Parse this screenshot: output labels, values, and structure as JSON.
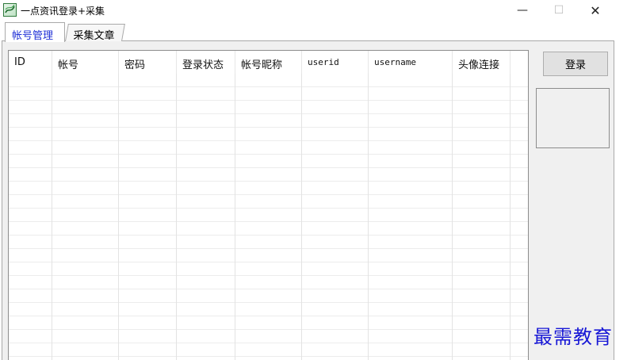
{
  "window": {
    "title": "一点资讯登录+采集",
    "minimize_glyph": "—",
    "maximize_glyph": "☐",
    "close_glyph": "✕"
  },
  "tabs": [
    {
      "label": "帐号管理",
      "active": true
    },
    {
      "label": "采集文章",
      "active": false
    }
  ],
  "table": {
    "columns": [
      "ID",
      "帐号",
      "密码",
      "登录状态",
      "帐号昵称",
      "userid",
      "username",
      "头像连接"
    ],
    "rows": []
  },
  "actions": {
    "login_label": "登录"
  },
  "watermark": "最需教育",
  "icons": {
    "app": "app-logo-icon",
    "minimize": "minimize-icon",
    "maximize": "maximize-icon",
    "close": "close-icon"
  },
  "colors": {
    "active_tab_text": "#1e2fd6",
    "watermark": "#1818d6",
    "panel_bg": "#f0f0f0"
  }
}
